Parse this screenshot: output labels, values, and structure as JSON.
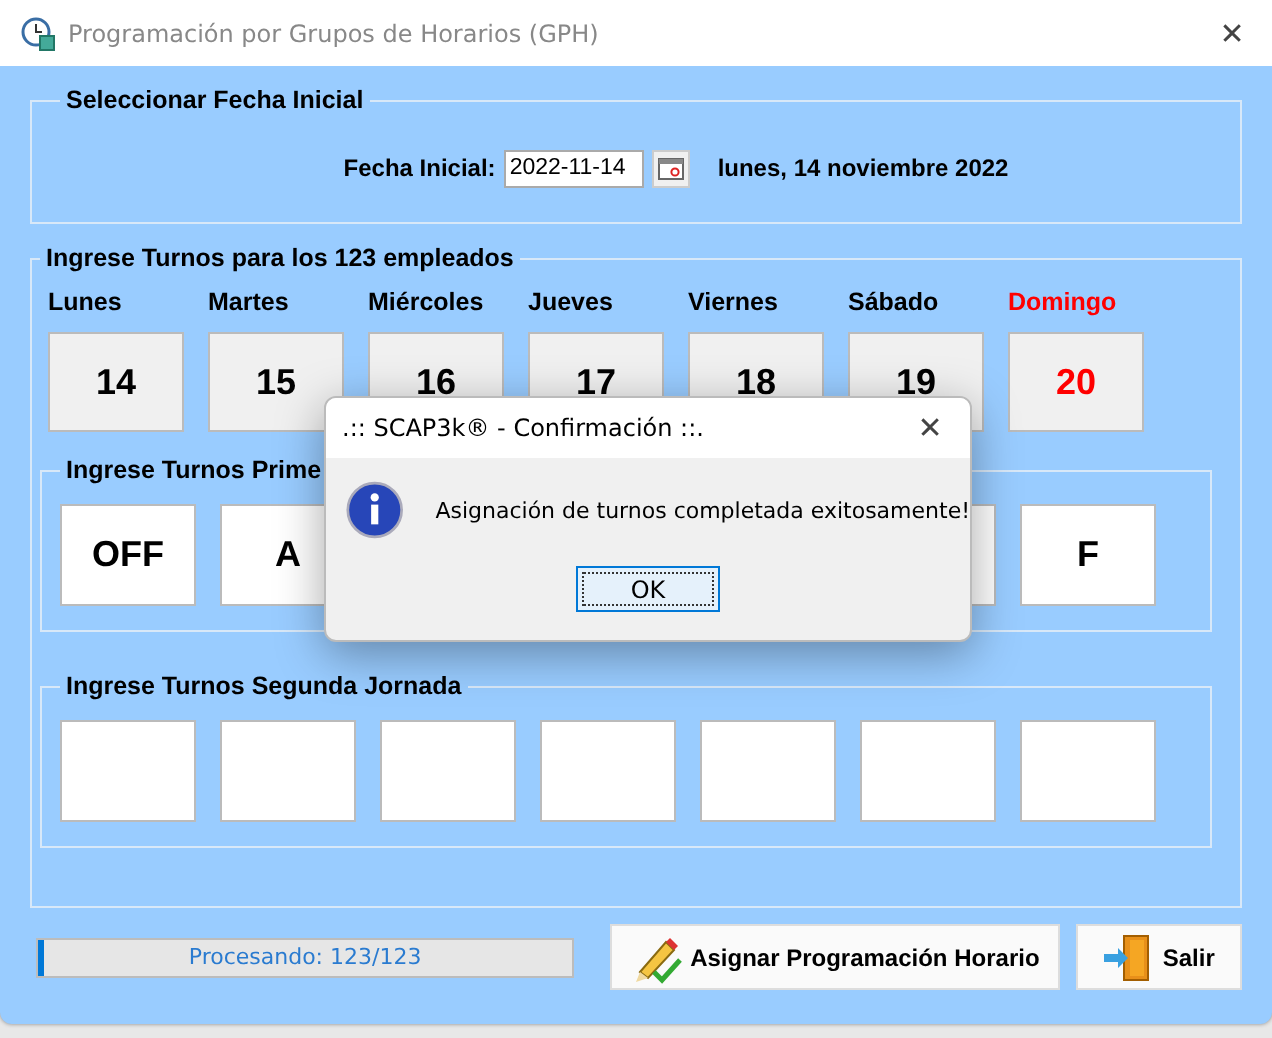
{
  "window": {
    "title": "Programación por Grupos de Horarios (GPH)",
    "close": "✕"
  },
  "start_date": {
    "legend": "Seleccionar Fecha Inicial",
    "label": "Fecha Inicial:",
    "value": "2022-11-14",
    "long_date": "lunes, 14 noviembre 2022"
  },
  "shifts": {
    "legend": "Ingrese Turnos para los 123 empleados",
    "days": [
      {
        "name": "Lunes",
        "date": "14",
        "highlighted": false
      },
      {
        "name": "Martes",
        "date": "15",
        "highlighted": false
      },
      {
        "name": "Miércoles",
        "date": "16",
        "highlighted": false
      },
      {
        "name": "Jueves",
        "date": "17",
        "highlighted": false
      },
      {
        "name": "Viernes",
        "date": "18",
        "highlighted": false
      },
      {
        "name": "Sábado",
        "date": "19",
        "highlighted": false
      },
      {
        "name": "Domingo",
        "date": "20",
        "highlighted": true
      }
    ],
    "first": {
      "legend": "Ingrese Turnos Prime",
      "cells": [
        {
          "value": "OFF",
          "kind": "field"
        },
        {
          "value": "A",
          "kind": "field"
        },
        {
          "kind": "covered"
        },
        {
          "kind": "covered"
        },
        {
          "kind": "covered"
        },
        {
          "kind": "field"
        },
        {
          "value": "F",
          "kind": "field"
        }
      ]
    },
    "second": {
      "legend": "Ingrese Turnos Segunda Jornada",
      "cells": [
        {},
        {},
        {},
        {},
        {},
        {},
        {}
      ]
    }
  },
  "progress": {
    "text": "Procesando: 123/123",
    "level": 0.01
  },
  "buttons": [
    {
      "label": "Asignar Programación Horario",
      "kind": "assign"
    },
    {
      "label": "Salir",
      "kind": "exit"
    }
  ],
  "dialog": {
    "title": ".:: SCAP3k® - Confirmación ::.",
    "close": "✕",
    "message": "Asignación de turnos completada exitosamente!",
    "button": "OK"
  }
}
